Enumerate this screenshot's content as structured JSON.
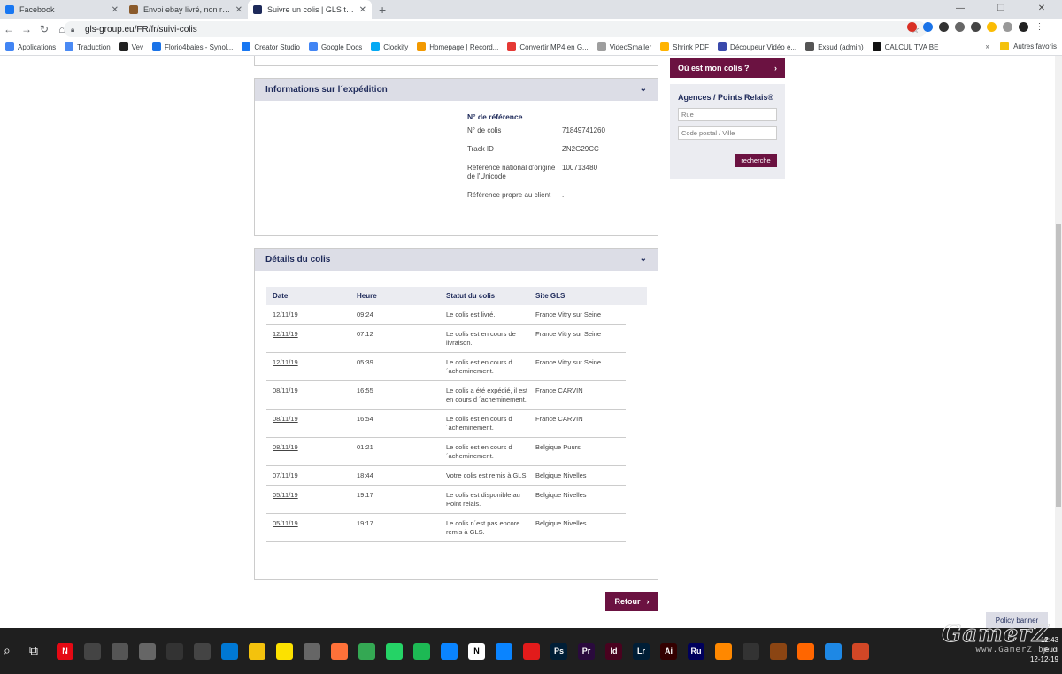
{
  "browser": {
    "tabs": [
      {
        "title": "Facebook",
        "color": "#1877f2"
      },
      {
        "title": "Envoi ebay livré, non reçu, garan",
        "color": "#8a5a2b"
      },
      {
        "title": "Suivre un colis | GLS transporteu",
        "color": "#1e2a5a"
      }
    ],
    "new_tab": "+",
    "url": "gls-group.eu/FR/fr/suivi-colis",
    "bookmarks": [
      {
        "label": "Applications",
        "color": "#4285f4"
      },
      {
        "label": "Traduction",
        "color": "#4a8af4"
      },
      {
        "label": "Vev",
        "color": "#222222"
      },
      {
        "label": "Florio4baies - Synol...",
        "color": "#1a73e8"
      },
      {
        "label": "Creator Studio",
        "color": "#1877f2"
      },
      {
        "label": "Google Docs",
        "color": "#4285f4"
      },
      {
        "label": "Clockify",
        "color": "#03a9f4"
      },
      {
        "label": "Homepage | Record...",
        "color": "#f29900"
      },
      {
        "label": "Convertir MP4 en G...",
        "color": "#e53935"
      },
      {
        "label": "VideoSmaller",
        "color": "#9e9e9e"
      },
      {
        "label": "Shrink PDF",
        "color": "#ffb300"
      },
      {
        "label": "Découpeur Vidéo e...",
        "color": "#3949ab"
      },
      {
        "label": "Exsud (admin)",
        "color": "#555555"
      },
      {
        "label": "CALCUL TVA BE",
        "color": "#111111"
      }
    ],
    "bookmarks_more": "»",
    "other_bookmarks": "Autres favoris"
  },
  "shipment_info": {
    "heading": "Informations sur l´expédition",
    "ref_title": "N° de référence",
    "rows": [
      {
        "label": "N° de colis",
        "value": "71849741260"
      },
      {
        "label": "Track ID",
        "value": "ZN2G29CC"
      },
      {
        "label": "Référence national d'origine de l'Unicode",
        "value": "100713480"
      },
      {
        "label": "Référence propre au client",
        "value": "."
      }
    ]
  },
  "details": {
    "heading": "Détails du colis",
    "columns": [
      "Date",
      "Heure",
      "Statut du colis",
      "Site GLS"
    ],
    "rows": [
      {
        "date": "12/11/19",
        "time": "09:24",
        "status": "Le colis est livré.",
        "site": "France Vitry sur Seine"
      },
      {
        "date": "12/11/19",
        "time": "07:12",
        "status": "Le colis est en cours de livraison.",
        "site": "France Vitry sur Seine"
      },
      {
        "date": "12/11/19",
        "time": "05:39",
        "status": "Le colis est en cours d ´acheminement.",
        "site": "France Vitry sur Seine"
      },
      {
        "date": "08/11/19",
        "time": "16:55",
        "status": "Le colis a été expédié, il est en cours d ´acheminement.",
        "site": "France CARVIN"
      },
      {
        "date": "08/11/19",
        "time": "16:54",
        "status": "Le colis est en cours d ´acheminement.",
        "site": "France CARVIN"
      },
      {
        "date": "08/11/19",
        "time": "01:21",
        "status": "Le colis est en cours d ´acheminement.",
        "site": "Belgique Puurs"
      },
      {
        "date": "07/11/19",
        "time": "18:44",
        "status": "Votre colis est remis à GLS.",
        "site": "Belgique Nivelles"
      },
      {
        "date": "05/11/19",
        "time": "19:17",
        "status": "Le colis est disponible au Point relais.",
        "site": "Belgique Nivelles"
      },
      {
        "date": "05/11/19",
        "time": "19:17",
        "status": "Le colis n´est pas encore remis à GLS.",
        "site": "Belgique Nivelles"
      }
    ]
  },
  "retour_label": "Retour",
  "sidebar": {
    "where_label": "Où est mon colis ?",
    "agences_heading": "Agences / Points Relais®",
    "street_placeholder": "Rue",
    "postal_placeholder": "Code postal / Ville",
    "search_label": "recherche"
  },
  "policy_banner": "Policy banner",
  "taskbar": {
    "icons": [
      {
        "name": "netflix",
        "color": "#e50914",
        "label": "N"
      },
      {
        "name": "calendar",
        "color": "#444444",
        "label": ""
      },
      {
        "name": "calculator",
        "color": "#555555",
        "label": ""
      },
      {
        "name": "photos",
        "color": "#666666",
        "label": ""
      },
      {
        "name": "xbox",
        "color": "#333333",
        "label": ""
      },
      {
        "name": "discord",
        "color": "#444444",
        "label": ""
      },
      {
        "name": "mail",
        "color": "#0078d4",
        "label": ""
      },
      {
        "name": "explorer",
        "color": "#f4c20d",
        "label": ""
      },
      {
        "name": "sticky-notes",
        "color": "#fce100",
        "label": ""
      },
      {
        "name": "store",
        "color": "#666666",
        "label": ""
      },
      {
        "name": "firefox",
        "color": "#ff7139",
        "label": ""
      },
      {
        "name": "chrome",
        "color": "#34a853",
        "label": ""
      },
      {
        "name": "whatsapp",
        "color": "#25d366",
        "label": ""
      },
      {
        "name": "spotify",
        "color": "#1db954",
        "label": ""
      },
      {
        "name": "info",
        "color": "#0a84ff",
        "label": ""
      },
      {
        "name": "notion",
        "color": "#ffffff",
        "label": "N"
      },
      {
        "name": "info2",
        "color": "#0a84ff",
        "label": ""
      },
      {
        "name": "acrobat",
        "color": "#e21b1b",
        "label": ""
      },
      {
        "name": "photoshop",
        "color": "#001e36",
        "label": "Ps"
      },
      {
        "name": "premiere",
        "color": "#2a0a3d",
        "label": "Pr"
      },
      {
        "name": "indesign",
        "color": "#49021f",
        "label": "Id"
      },
      {
        "name": "lightroom",
        "color": "#001e36",
        "label": "Lr"
      },
      {
        "name": "illustrator",
        "color": "#330000",
        "label": "Ai"
      },
      {
        "name": "rush",
        "color": "#00005b",
        "label": "Ru"
      },
      {
        "name": "vlc",
        "color": "#ff8800",
        "label": ""
      },
      {
        "name": "app1",
        "color": "#333333",
        "label": ""
      },
      {
        "name": "app2",
        "color": "#8b4513",
        "label": ""
      },
      {
        "name": "app3",
        "color": "#ff6600",
        "label": ""
      },
      {
        "name": "app4",
        "color": "#1e88e5",
        "label": ""
      },
      {
        "name": "powerpoint",
        "color": "#d24726",
        "label": ""
      }
    ],
    "time": "12:43",
    "day": "jeudi",
    "date": "12-12-19",
    "watermark": "GamerZ",
    "watermark_url": "www.GamerZ.be"
  }
}
